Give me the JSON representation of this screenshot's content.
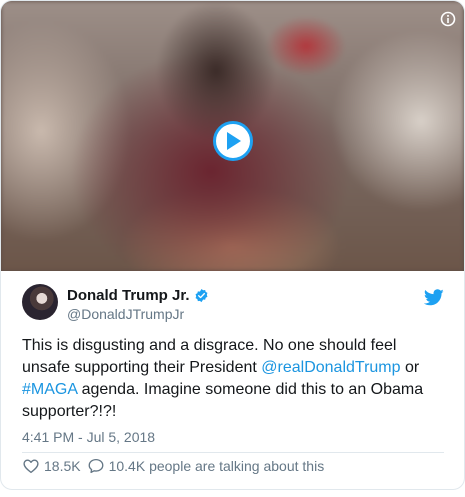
{
  "tweet": {
    "author_name": "Donald Trump Jr.",
    "author_handle": "@DonaldJTrumpJr",
    "text_parts": [
      "This is disgusting and a disgrace. No one should feel unsafe supporting their President ",
      "@realDonaldTrump",
      " or ",
      "#MAGA",
      " agenda. Imagine someone did this to an Obama supporter?!?!"
    ],
    "timestamp": "4:41 PM - Jul 5, 2018",
    "likes": "18.5K",
    "replies_text": "10.4K people are talking about this"
  },
  "colors": {
    "accent": "#1da1f2",
    "link": "#1b95e0",
    "muted": "#657786",
    "border": "#e1e8ed"
  },
  "icons": [
    "play-icon",
    "info-icon",
    "verified-icon",
    "twitter-bird-icon",
    "heart-icon",
    "speech-bubble-icon"
  ]
}
